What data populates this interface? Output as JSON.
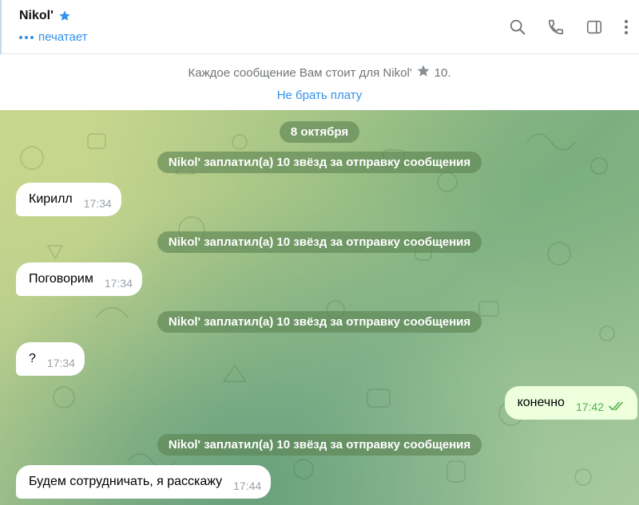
{
  "header": {
    "title": "Nikol'",
    "status": "печатает",
    "icons": [
      "search-icon",
      "phone-icon",
      "sidebar-toggle-icon",
      "more-vertical-icon"
    ]
  },
  "banner": {
    "notice": "Каждое сообщение Вам стоит для Nikol'",
    "price": "10.",
    "link": "Не брать плату"
  },
  "chat": {
    "date": "8 октября",
    "service_text": "Nikol' заплатил(а) 10 звёзд за отправку сообщения",
    "messages": [
      {
        "text": "Кирилл",
        "time": "17:34",
        "direction": "in"
      },
      {
        "text": "Поговорим",
        "time": "17:34",
        "direction": "in"
      },
      {
        "text": "?",
        "time": "17:34",
        "direction": "in"
      },
      {
        "text": "конечно",
        "time": "17:42",
        "direction": "out"
      },
      {
        "text": "Будем сотрудничать, я расскажу",
        "time": "17:44",
        "direction": "in"
      }
    ]
  },
  "colors": {
    "accent": "#3390ec",
    "service_bg": "#5c8252",
    "outgoing_bg": "#eeffde",
    "read_check": "#4fae4e"
  }
}
